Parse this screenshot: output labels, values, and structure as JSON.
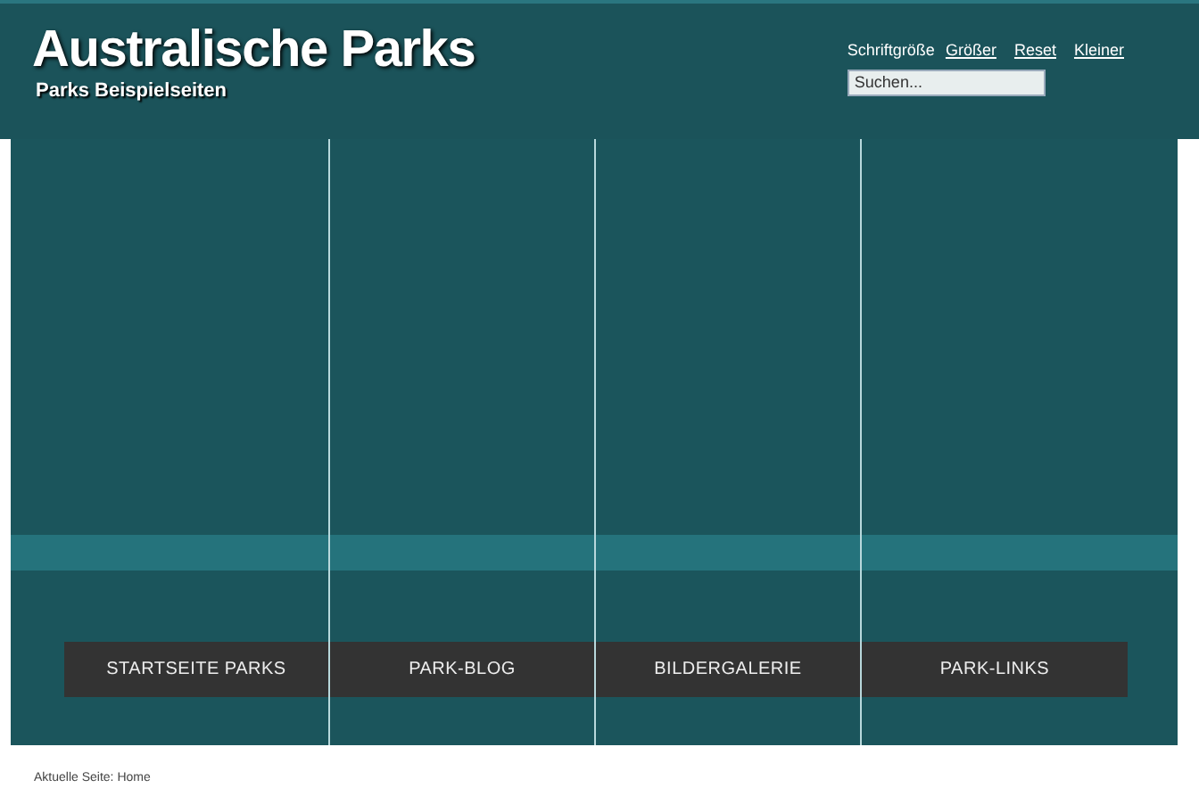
{
  "header": {
    "title": "Australische Parks",
    "subtitle": "Parks Beispielseiten"
  },
  "font_size": {
    "label": "Schriftgröße",
    "links": [
      "Größer",
      "Reset",
      "Kleiner"
    ]
  },
  "search": {
    "placeholder": "Suchen..."
  },
  "nav": [
    {
      "label": "STARTSEITE PARKS"
    },
    {
      "label": "PARK-BLOG"
    },
    {
      "label": "BILDERGALERIE"
    },
    {
      "label": "PARK-LINKS"
    }
  ],
  "breadcrumb": "Aktuelle Seite: Home"
}
